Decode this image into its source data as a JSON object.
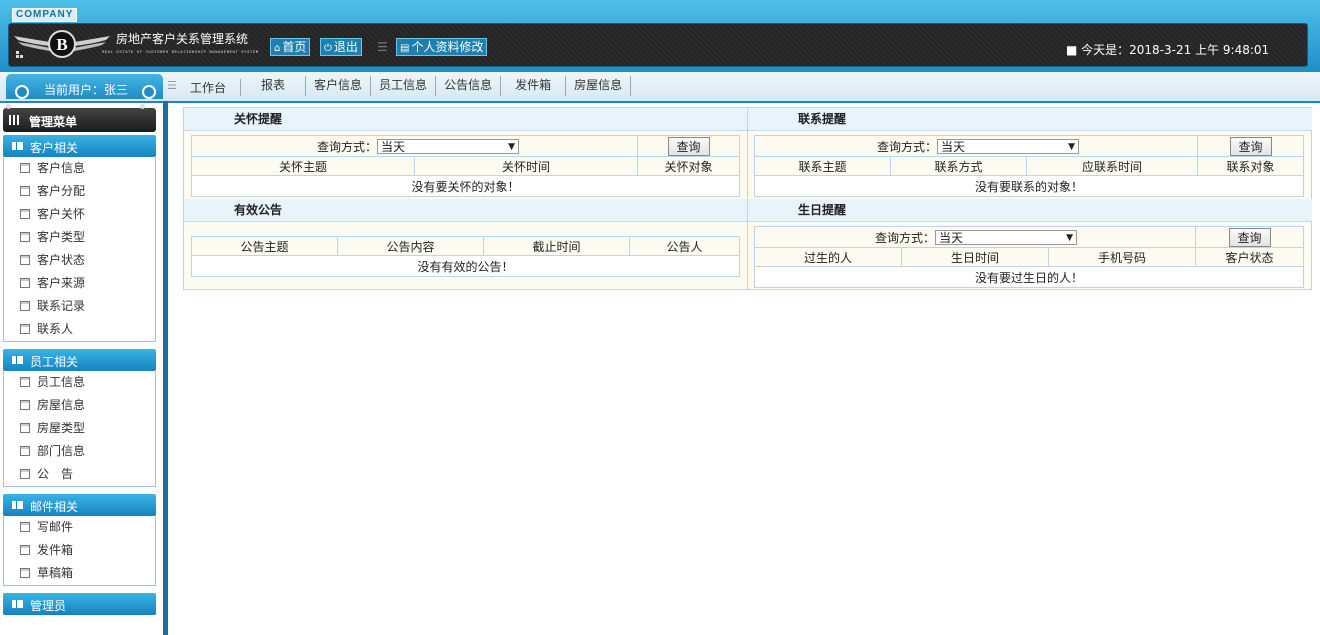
{
  "header": {
    "company": "COMPANY",
    "title": "房地产客户关系管理系统",
    "subtitle": "REAL ESTATE OF CUSTOMER RELATIONSHIP MANAGEMENT SYSTEM",
    "home_label": "首页",
    "logout_label": "退出",
    "profile_label": "个人资料修改",
    "today": "■ 今天是：2018-3-21 上午 9:48:01"
  },
  "navbar": {
    "current_user": "当前用户：张三",
    "items": [
      "工作台",
      "报表",
      "客户信息",
      "员工信息",
      "公告信息",
      "发件箱",
      "房屋信息"
    ]
  },
  "sidebar": {
    "menu_title": "管理菜单",
    "groups": [
      {
        "label": "客户相关",
        "items": [
          "客户信息",
          "客户分配",
          "客户关怀",
          "客户类型",
          "客户状态",
          "客户来源",
          "联系记录",
          "联系人"
        ]
      },
      {
        "label": "员工相关",
        "items": [
          "员工信息",
          "房屋信息",
          "房屋类型",
          "部门信息",
          "公　告"
        ]
      },
      {
        "label": "邮件相关",
        "items": [
          "写邮件",
          "发件箱",
          "草稿箱"
        ]
      },
      {
        "label": "管理员",
        "items": []
      }
    ]
  },
  "panels": {
    "care": {
      "title": "关怀提醒",
      "query_label": "查询方式：",
      "select_value": "当天",
      "button": "查询",
      "columns": [
        "关怀主题",
        "关怀时间",
        "关怀对象"
      ],
      "empty": "没有要关怀的对象！"
    },
    "contact": {
      "title": "联系提醒",
      "query_label": "查询方式：",
      "select_value": "当天",
      "button": "查询",
      "columns": [
        "联系主题",
        "联系方式",
        "应联系时间",
        "联系对象"
      ],
      "empty": "没有要联系的对象！"
    },
    "notice": {
      "title": "有效公告",
      "columns": [
        "公告主题",
        "公告内容",
        "截止时间",
        "公告人"
      ],
      "empty": "没有有效的公告！"
    },
    "birthday": {
      "title": "生日提醒",
      "query_label": "查询方式：",
      "select_value": "当天",
      "button": "查询",
      "columns": [
        "过生的人",
        "生日时间",
        "手机号码",
        "客户状态"
      ],
      "empty": "没有要过生日的人！"
    }
  },
  "colors": {
    "header_blue": "#1f8fc7",
    "sidebar_group": "#1583bf",
    "panel_bg": "#fdfbef"
  }
}
